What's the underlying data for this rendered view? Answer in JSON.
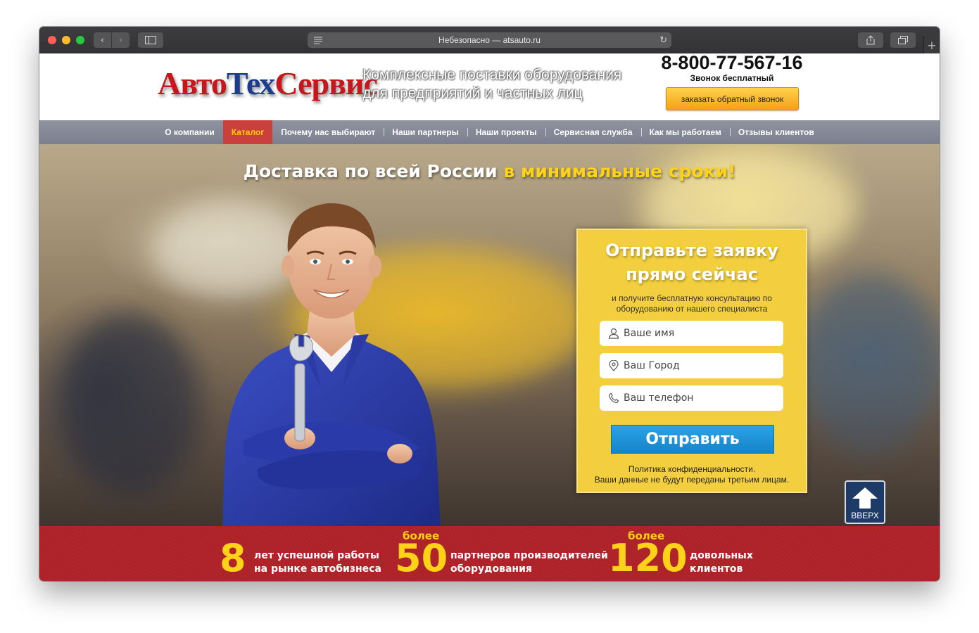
{
  "browser": {
    "address": "Небезопасно — atsauto.ru"
  },
  "header": {
    "logo": {
      "part1": "Авто",
      "part2": "Тех",
      "part3": "Сервис"
    },
    "tagline": "Комплексные поставки оборудования для предприятий и частных лиц",
    "phone": "8-800-77-567-16",
    "phone_note": "Звонок бесплатный",
    "callback_label": "заказать обратный звонок"
  },
  "nav": {
    "items": [
      {
        "label": "О компании"
      },
      {
        "label": "Каталог",
        "active": true
      },
      {
        "label": "Почему нас выбирают"
      },
      {
        "label": "Наши партнеры"
      },
      {
        "label": "Наши проекты"
      },
      {
        "label": "Сервисная служба"
      },
      {
        "label": "Как мы работаем"
      },
      {
        "label": "Отзывы клиентов"
      }
    ]
  },
  "hero": {
    "title_main": "Доставка по всей России ",
    "title_highlight": "в минимальные сроки!"
  },
  "form": {
    "title_line1": "Отправьте заявку",
    "title_line2": "прямо сейчас",
    "subtitle": "и получите бесплатную консультацию по оборудованию от нашего специалиста",
    "name_placeholder": "Ваше имя",
    "city_placeholder": "Ваш Город",
    "phone_placeholder": "Ваш телефон",
    "submit_label": "Отправить",
    "privacy_line1": "Политика конфиденциальности.",
    "privacy_line2": "Ваши данные не будут переданы третьим лицам."
  },
  "to_top_label": "ВВЕРХ",
  "stats": [
    {
      "prefix": "",
      "number": "8",
      "line1": "лет успешной работы",
      "line2": "на рынке автобизнеса"
    },
    {
      "prefix": "более",
      "number": "50",
      "line1": "партнеров производителей",
      "line2": "оборудования"
    },
    {
      "prefix": "более",
      "number": "120",
      "line1": "довольных",
      "line2": "клиентов"
    }
  ],
  "colors": {
    "nav_active_bg": "#c9403c",
    "highlight_yellow": "#ffd21a",
    "form_bg": "#f3cf3f",
    "submit_blue": "#1e93d8",
    "stats_red": "#b3252b"
  }
}
